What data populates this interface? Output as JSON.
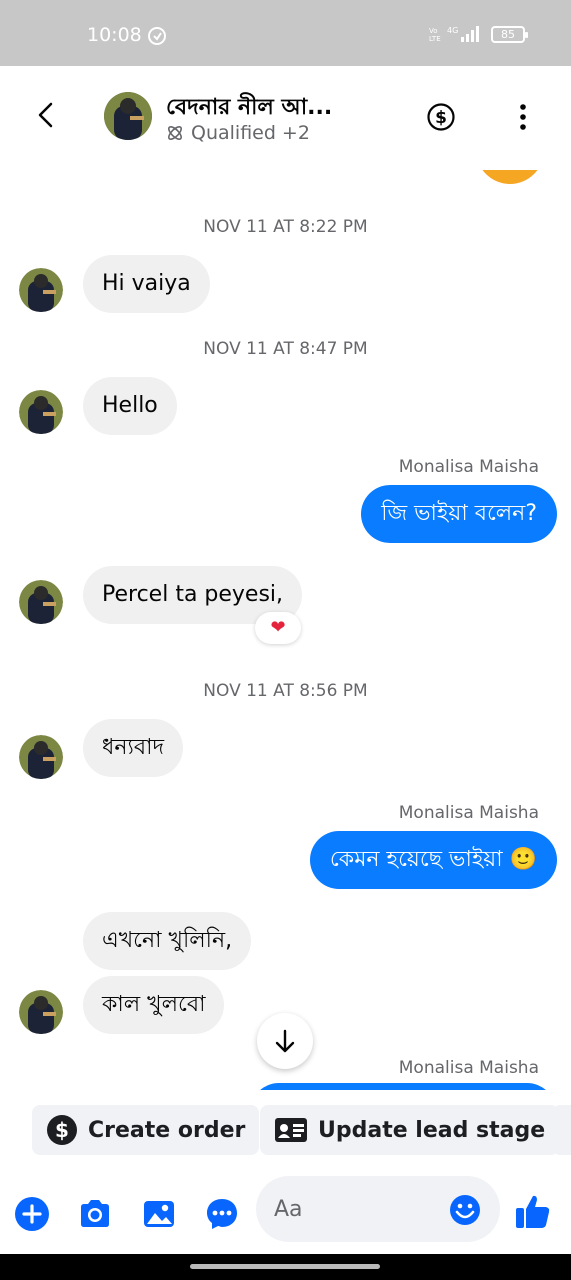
{
  "status_bar": {
    "time": "10:08",
    "battery": "85"
  },
  "header": {
    "contact_name": "বেদনার নীল আ...",
    "tag": "Qualified",
    "tag_extra": "+2"
  },
  "messages": {
    "sep1": "NOV 11 AT 8:22 PM",
    "msg1": "Hi vaiya",
    "sep2": "NOV 11 AT 8:47 PM",
    "msg2": "Hello",
    "sender1": "Monalisa Maisha",
    "out1": "জি ভাইয়া বলেন?",
    "msg3": "Percel ta peyesi,",
    "reaction3": "❤",
    "sep3": "NOV 11 AT 8:56 PM",
    "msg4": "ধন্যবাদ",
    "sender2": "Monalisa Maisha",
    "out2": "কেমন হয়েছে ভাইয়া 🙂",
    "msg5": "এখনো খুলিনি,",
    "msg6": "কাল খুলবো",
    "sender3": "Monalisa Maisha"
  },
  "actions": {
    "create_order": "Create order",
    "update_lead_stage": "Update lead stage"
  },
  "composer": {
    "placeholder": "Aa"
  },
  "colors": {
    "accent": "#0a7cff",
    "incoming_bubble": "#f0f0f0",
    "icon_blue": "#0866ff",
    "status_bar": "#c7c7c7"
  },
  "icons": {
    "back": "chevron-left-icon",
    "dollar": "dollar-circle-icon",
    "menu": "more-vertical-icon",
    "add": "plus-circle-icon",
    "camera": "camera-icon",
    "gallery": "image-icon",
    "chat_bubble": "chat-dots-icon",
    "emoji": "smiley-icon",
    "like": "thumbs-up-icon",
    "scroll_down": "arrow-down-icon",
    "lead": "id-card-icon"
  }
}
